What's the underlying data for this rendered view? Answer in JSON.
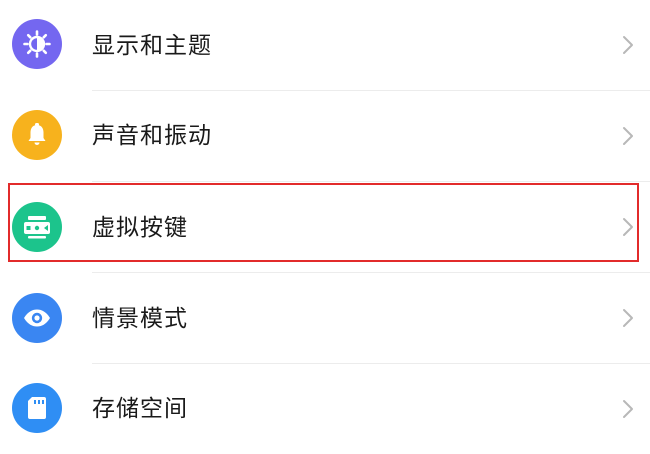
{
  "colors": {
    "display_icon_bg": "#7467f0",
    "sound_icon_bg": "#f7b21d",
    "nav_keys_icon_bg": "#1cc48c",
    "scene_icon_bg": "#3a86f2",
    "storage_icon_bg": "#2f8ef4",
    "highlight_border": "#e22b2b",
    "chevron": "#b8b8b8"
  },
  "settings": {
    "items": [
      {
        "label": "显示和主题",
        "icon": "brightness-icon"
      },
      {
        "label": "声音和振动",
        "icon": "bell-icon"
      },
      {
        "label": "虚拟按键",
        "icon": "virtual-keys-icon",
        "highlighted": true
      },
      {
        "label": "情景模式",
        "icon": "eye-icon"
      },
      {
        "label": "存储空间",
        "icon": "sd-card-icon"
      }
    ]
  }
}
